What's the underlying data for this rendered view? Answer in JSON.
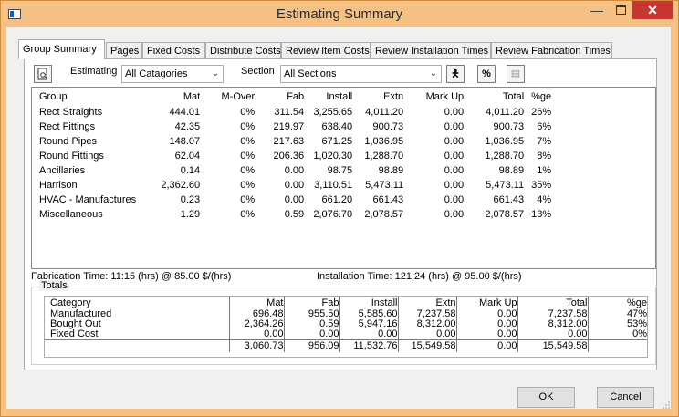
{
  "window": {
    "title": "Estimating Summary"
  },
  "tabs": [
    "Group Summary",
    "Pages",
    "Fixed Costs",
    "Distribute Costs",
    "Review Item Costs",
    "Review Installation Times",
    "Review Fabrication Times"
  ],
  "filters": {
    "estimating_label": "Estimating",
    "estimating_value": "All Catagories",
    "section_label": "Section",
    "section_value": "All Sections"
  },
  "groups": {
    "headers": [
      "Group",
      "Mat",
      "M-Over",
      "Fab",
      "Install",
      "Extn",
      "Mark Up",
      "Total",
      "%ge"
    ],
    "rows": [
      [
        "Rect Straights",
        "444.01",
        "0%",
        "311.54",
        "3,255.65",
        "4,011.20",
        "0.00",
        "4,011.20",
        "26%"
      ],
      [
        "Rect Fittings",
        "42.35",
        "0%",
        "219.97",
        "638.40",
        "900.73",
        "0.00",
        "900.73",
        "6%"
      ],
      [
        "Round Pipes",
        "148.07",
        "0%",
        "217.63",
        "671.25",
        "1,036.95",
        "0.00",
        "1,036.95",
        "7%"
      ],
      [
        "Round Fittings",
        "62.04",
        "0%",
        "206.36",
        "1,020.30",
        "1,288.70",
        "0.00",
        "1,288.70",
        "8%"
      ],
      [
        "Ancillaries",
        "0.14",
        "0%",
        "0.00",
        "98.75",
        "98.89",
        "0.00",
        "98.89",
        "1%"
      ],
      [
        "Harrison",
        "2,362.60",
        "0%",
        "0.00",
        "3,110.51",
        "5,473.11",
        "0.00",
        "5,473.11",
        "35%"
      ],
      [
        "HVAC - Manufactures",
        "0.23",
        "0%",
        "0.00",
        "661.20",
        "661.43",
        "0.00",
        "661.43",
        "4%"
      ],
      [
        "Miscellaneous",
        "1.29",
        "0%",
        "0.59",
        "2,076.70",
        "2,078.57",
        "0.00",
        "2,078.57",
        "13%"
      ]
    ]
  },
  "status": {
    "fabrication": "Fabrication Time: 11:15 (hrs) @ 85.00 $/(hrs)",
    "installation": "Installation Time: 121:24 (hrs) @ 95.00 $/(hrs)"
  },
  "totals": {
    "label": "Totals",
    "headers": [
      "Category",
      "Mat",
      "Fab",
      "Install",
      "Extn",
      "Mark Up",
      "Total",
      "%ge"
    ],
    "rows": [
      [
        "Manufactured",
        "696.48",
        "955.50",
        "5,585.60",
        "7,237.58",
        "0.00",
        "7,237.58",
        "47%"
      ],
      [
        "Bought Out",
        "2,364.26",
        "0.59",
        "5,947.16",
        "8,312.00",
        "0.00",
        "8,312.00",
        "53%"
      ],
      [
        "Fixed Cost",
        "0.00",
        "0.00",
        "0.00",
        "0.00",
        "0.00",
        "0.00",
        "0%"
      ]
    ],
    "sum": [
      "",
      "3,060.73",
      "956.09",
      "11,532.76",
      "15,549.58",
      "0.00",
      "15,549.58",
      ""
    ]
  },
  "buttons": {
    "ok": "OK",
    "cancel": "Cancel"
  },
  "colors": {
    "titlebar": "#f4c084",
    "close": "#c7372f",
    "border": "#d08a3c"
  }
}
